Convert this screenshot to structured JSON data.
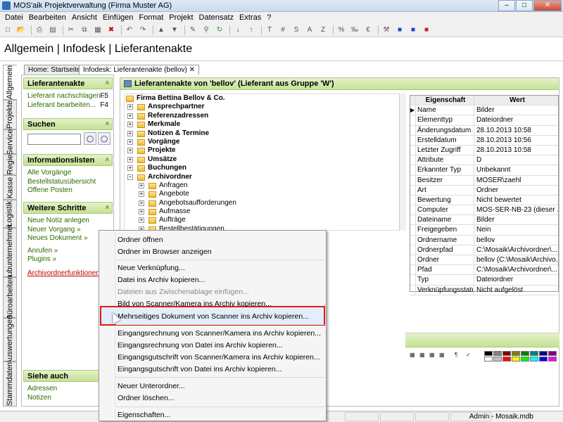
{
  "window": {
    "title": "MOS'aik Projektverwaltung (Firma Muster AG)"
  },
  "menubar": [
    "Datei",
    "Bearbeiten",
    "Ansicht",
    "Einfügen",
    "Format",
    "Projekt",
    "Datensatz",
    "Extras",
    "?"
  ],
  "toolbar": {
    "icons": [
      "new-icon",
      "open-icon",
      "print-icon",
      "preview-icon",
      "cut-icon",
      "copy-icon",
      "paste-icon",
      "delete-icon",
      "undo-icon",
      "redo-icon",
      "up-icon",
      "down-icon",
      "edit-icon",
      "find-icon",
      "refresh-icon",
      "sort-asc-icon",
      "sort-desc-icon",
      "T",
      "#",
      "S",
      "A",
      "Z",
      "%",
      "‰",
      "€",
      "tools-icon",
      "user-blue-icon",
      "user-blue2-icon",
      "user-red-icon"
    ]
  },
  "page_title": "Allgemein | Infodesk | Lieferantenakte",
  "vertical_tabs": [
    "Allgemein",
    "Projekte",
    "Service",
    "Regie",
    "Kasse",
    "Logistik",
    "Subunternehmer",
    "Büroarbeiten",
    "Auswertungen",
    "Stammdaten"
  ],
  "tabs": [
    "Home: Startseite",
    "Infodesk: Lieferantenakte (bellov)"
  ],
  "sidebar": {
    "lieferantenakte": {
      "title": "Lieferantenakte",
      "items": [
        {
          "label": "Lieferant nachschlagen...",
          "key": "F5"
        },
        {
          "label": "Lieferant bearbeiten...",
          "key": "F4"
        }
      ]
    },
    "suchen": {
      "title": "Suchen"
    },
    "informationslisten": {
      "title": "Informationslisten",
      "items": [
        "Alle Vorgänge",
        "Bestellstatusübersicht",
        "Offene Posten"
      ]
    },
    "weitere_schritte": {
      "title": "Weitere Schritte",
      "items": [
        "Neue Notiz anlegen",
        "Neuer Vorgang »",
        "Neues Dokument »",
        "Anrufen »",
        "Plugins »",
        "Archivordnerfunktionen »"
      ]
    },
    "siehe_auch": {
      "title": "Siehe auch",
      "items": [
        "Adressen",
        "Notizen"
      ]
    }
  },
  "main": {
    "header": "Lieferantenakte von 'bellov' (Lieferant aus Gruppe 'W')",
    "tree": [
      {
        "label": "Firma Bettina Bellov & Co.",
        "bold": true,
        "level": 0
      },
      {
        "label": "Ansprechpartner",
        "bold": true,
        "level": 1
      },
      {
        "label": "Referenzadressen",
        "bold": true,
        "level": 1
      },
      {
        "label": "Merkmale",
        "bold": true,
        "level": 1
      },
      {
        "label": "Notizen & Termine",
        "bold": true,
        "level": 1
      },
      {
        "label": "Vorgänge",
        "bold": true,
        "level": 1
      },
      {
        "label": "Projekte",
        "bold": true,
        "level": 1
      },
      {
        "label": "Umsätze",
        "bold": true,
        "level": 1
      },
      {
        "label": "Buchungen",
        "bold": true,
        "level": 1
      },
      {
        "label": "Archivordner",
        "bold": true,
        "level": 1
      },
      {
        "label": "Anfragen",
        "bold": false,
        "level": 2
      },
      {
        "label": "Angebote",
        "bold": false,
        "level": 2
      },
      {
        "label": "Angebotsaufforderungen",
        "bold": false,
        "level": 2
      },
      {
        "label": "Aufmasse",
        "bold": false,
        "level": 2
      },
      {
        "label": "Aufträge",
        "bold": false,
        "level": 2
      },
      {
        "label": "Bestellbestätigungen",
        "bold": false,
        "level": 2
      }
    ],
    "properties": {
      "header": {
        "name": "Eigenschaft",
        "value": "Wert"
      },
      "rows": [
        {
          "name": "Name",
          "value": "Bilder"
        },
        {
          "name": "Elementtyp",
          "value": "Dateiordner"
        },
        {
          "name": "Änderungsdatum",
          "value": "28.10.2013 10:58"
        },
        {
          "name": "Erstelldatum",
          "value": "28.10.2013 10:56"
        },
        {
          "name": "Letzter Zugriff",
          "value": "28.10.2013 10:58"
        },
        {
          "name": "Attribute",
          "value": "D"
        },
        {
          "name": "Erkannter Typ",
          "value": "Unbekannt"
        },
        {
          "name": "Besitzer",
          "value": "MOSER\\zaehl"
        },
        {
          "name": "Art",
          "value": "Ordner"
        },
        {
          "name": "Bewertung",
          "value": "Nicht bewertet"
        },
        {
          "name": "Computer",
          "value": "MOS-SER-NB-23 (dieser ..."
        },
        {
          "name": "Dateiname",
          "value": "Bilder"
        },
        {
          "name": "Freigegeben",
          "value": "Nein"
        },
        {
          "name": "Ordnername",
          "value": "bellov"
        },
        {
          "name": "Ordnerpfad",
          "value": "C:\\Mosaik\\Archivordner\\..."
        },
        {
          "name": "Ordner",
          "value": "bellov (C:\\Mosaik\\Archivo..."
        },
        {
          "name": "Pfad",
          "value": "C:\\Mosaik\\Archivordner\\..."
        },
        {
          "name": "Typ",
          "value": "Dateiordner"
        },
        {
          "name": "Verknüpfungsstatus",
          "value": "Nicht aufgelöst"
        }
      ]
    }
  },
  "context_menu": {
    "items": [
      {
        "label": "Ordner öffnen",
        "disabled": false
      },
      {
        "label": "Ordner im Browser anzeigen",
        "disabled": false
      },
      {
        "label": "Neue Verknüpfung...",
        "disabled": false
      },
      {
        "label": "Datei ins Archiv kopieren...",
        "disabled": false
      },
      {
        "label": "Dateien aus Zwischenablage einfügen...",
        "disabled": true
      },
      {
        "label": "Bild von Scanner/Kamera ins Archiv kopieren...",
        "disabled": false
      },
      {
        "label": "Mehrseitiges Dokument von Scanner ins Archiv kopieren...",
        "disabled": false,
        "highlighted": true
      },
      {
        "label": "Eingangsrechnung von Scanner/Kamera ins Archiv kopieren...",
        "disabled": false
      },
      {
        "label": "Eingangsrechnung von Datei ins Archiv kopieren...",
        "disabled": false
      },
      {
        "label": "Eingangsgutschrift von Scanner/Kamera ins Archiv kopieren...",
        "disabled": false
      },
      {
        "label": "Eingangsgutschrift von Datei ins Archiv kopieren...",
        "disabled": false
      },
      {
        "label": "Neuer Unterordner...",
        "disabled": false
      },
      {
        "label": "Ordner löschen...",
        "disabled": false
      },
      {
        "label": "Eigenschaften...",
        "disabled": false
      }
    ]
  },
  "statusbar": {
    "text": "Admin - Mosaik.mdb"
  },
  "colors": {
    "accent_green": "#c6e196",
    "highlight_red": "#e01818",
    "link_green": "#2a6a00",
    "link_red": "#c00000"
  }
}
